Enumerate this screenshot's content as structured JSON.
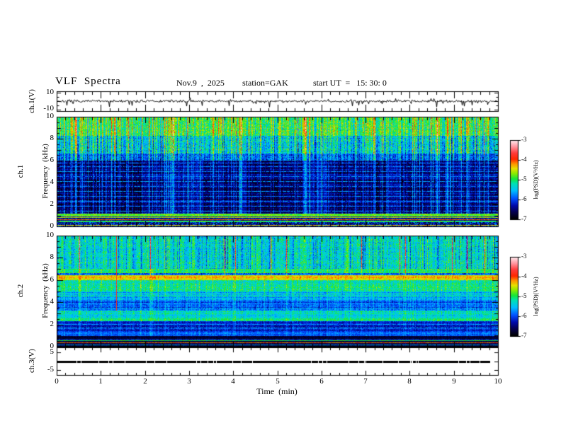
{
  "header": {
    "title": "VLF  Spectra",
    "date": "Nov.9  ,  2025",
    "station": "station=GAK",
    "start_ut": "start UT  =   15: 30: 0"
  },
  "panels": {
    "ch1_wave": {
      "ylabel": "ch.1(V)",
      "yticks": [
        "10",
        "-10"
      ]
    },
    "spec1": {
      "channel": "ch.1",
      "ylabel": "Frequency  (kHz)",
      "yticks": [
        "10",
        "8",
        "6",
        "4",
        "2",
        "0"
      ]
    },
    "spec2": {
      "channel": "ch.2",
      "ylabel": "Frequency  (kHz)",
      "yticks": [
        "10",
        "8",
        "6",
        "4",
        "2",
        "0"
      ]
    },
    "ch3_wave": {
      "ylabel": "ch.3(V)",
      "yticks": [
        "5",
        "-5"
      ]
    }
  },
  "xaxis": {
    "label": "Time  (min)",
    "lim_min": [
      0,
      10
    ],
    "tick_labels": [
      "0",
      "1",
      "2",
      "3",
      "4",
      "5",
      "6",
      "7",
      "8",
      "9",
      "10"
    ],
    "minor_step_min": 0.2
  },
  "colorbar": {
    "label": "log(PSD)(V²/Hz)",
    "ticks": [
      "-3",
      "-4",
      "-5",
      "-6",
      "-7"
    ],
    "range": [
      -7,
      -3
    ]
  },
  "chart_data": [
    {
      "type": "line",
      "name": "ch.1 voltage waveform",
      "ylabel": "ch.1(V)",
      "ylim": [
        -10,
        10
      ],
      "x_range_min": [
        0,
        10
      ],
      "seed": 7,
      "noise_std_v": 0.75,
      "neg_spike_prob": 0.045,
      "neg_spike_depth_v": [
        2,
        6.5
      ],
      "pos_spike_prob": 0.012,
      "pos_spike_height_v": [
        1.5,
        4
      ]
    },
    {
      "type": "heatmap",
      "name": "ch.1 VLF spectrogram",
      "ylabel": "ch.1 Frequency (kHz)",
      "ylim_khz": [
        0,
        10
      ],
      "x_range_min": [
        0,
        10
      ],
      "z_label": "log(PSD)(V²/Hz)",
      "z_range": [
        -7,
        -3
      ],
      "seed": 11,
      "bands": [
        {
          "f_khz": [
            8.3,
            10.0
          ],
          "level": -5.0,
          "noise": 0.45,
          "colvar": 0.5,
          "streak": 0.9,
          "rowvar": 0.15
        },
        {
          "f_khz": [
            6.7,
            8.3
          ],
          "level": -5.5,
          "noise": 0.5,
          "colvar": 0.55,
          "streak": 1.0,
          "rowvar": 0.2
        },
        {
          "f_khz": [
            6.05,
            6.7
          ],
          "level": -5.95,
          "noise": 0.45,
          "colvar": 0.4,
          "streak": 1.0,
          "rowvar": 0.25
        },
        {
          "f_khz": [
            1.2,
            6.05
          ],
          "level": -6.5,
          "noise": 0.28,
          "colvar": 0.18,
          "streak": 0.95,
          "rowvar": 0.5,
          "blocky": 0.55
        },
        {
          "f_khz": [
            0.78,
            1.2
          ],
          "level": -4.75,
          "noise": 0.3,
          "colvar": 0.1,
          "streak": 0.15,
          "rowvar": 0.5
        },
        {
          "f_khz": [
            0.55,
            0.78
          ],
          "level": -6.5,
          "noise": 0.4,
          "colvar": 0.1,
          "streak": 0.15,
          "rowvar": 0.4
        },
        {
          "f_khz": [
            0.38,
            0.55
          ],
          "level": -5.2,
          "noise": 0.4,
          "colvar": 0.1,
          "streak": 0.1,
          "rowvar": 0.4
        },
        {
          "f_khz": [
            0.0,
            0.38
          ],
          "level": -6.3,
          "noise": 0.8,
          "colvar": 0.1,
          "streak": 0.1,
          "rowvar": 0.4
        }
      ],
      "row_lines": [
        {
          "f_khz": 1.45,
          "boost": 0.8
        },
        {
          "f_khz": 1.9,
          "boost": 0.7
        },
        {
          "f_khz": 2.35,
          "boost": 0.8
        },
        {
          "f_khz": 2.8,
          "boost": 0.7
        },
        {
          "f_khz": 3.25,
          "boost": 0.8
        },
        {
          "f_khz": 3.7,
          "boost": 0.7
        },
        {
          "f_khz": 4.15,
          "boost": 0.8
        },
        {
          "f_khz": 4.6,
          "boost": 0.7
        },
        {
          "f_khz": 5.05,
          "boost": 0.75
        },
        {
          "f_khz": 5.5,
          "boost": 0.7
        },
        {
          "f_khz": 5.85,
          "boost": 0.7
        }
      ],
      "solid_rows": [
        {
          "f_khz": 1.08,
          "level": -4.8
        },
        {
          "f_khz": 0.98,
          "level": -4.6
        },
        {
          "f_khz": 0.88,
          "level": -6.3
        },
        {
          "f_khz": 0.65,
          "level": -4.1
        },
        {
          "f_khz": 0.45,
          "level": -5.0
        },
        {
          "f_khz": 0.12,
          "level": -4.4
        }
      ],
      "streaks": {
        "strong_times_min": [
          1.3,
          2.62,
          4.17,
          5.63,
          7.2,
          8.62
        ]
      }
    },
    {
      "type": "heatmap",
      "name": "ch.2 VLF spectrogram",
      "ylabel": "ch.2 Frequency (kHz)",
      "ylim_khz": [
        0,
        10
      ],
      "x_range_min": [
        0,
        10
      ],
      "z_label": "log(PSD)(V²/Hz)",
      "z_range": [
        -7,
        -3
      ],
      "seed": 23,
      "red_column_min": 1.33,
      "bands": [
        {
          "f_khz": [
            7.05,
            10.0
          ],
          "level": -5.2,
          "noise": 0.4,
          "colvar": 0.35,
          "streak": -0.85,
          "rowvar": 0.2
        },
        {
          "f_khz": [
            6.65,
            7.05
          ],
          "level": -5.05,
          "noise": 0.3,
          "colvar": 0.2,
          "streak": 0.3,
          "rowvar": 0.3
        },
        {
          "f_khz": [
            6.5,
            6.65
          ],
          "level": -5.9,
          "noise": 0.4,
          "colvar": 0.15,
          "streak": 0.3,
          "rowvar": 0.3
        },
        {
          "f_khz": [
            6.05,
            6.5
          ],
          "level": -4.4,
          "noise": 0.28,
          "colvar": 0.15,
          "streak": 0.2,
          "rowvar": 0.3
        },
        {
          "f_khz": [
            5.0,
            6.05
          ],
          "level": -5.25,
          "noise": 0.35,
          "colvar": 0.2,
          "streak": 0.4,
          "rowvar": 0.5
        },
        {
          "f_khz": [
            4.25,
            5.0
          ],
          "level": -5.6,
          "noise": 0.3,
          "colvar": 0.15,
          "streak": 0.4,
          "rowvar": 0.5
        },
        {
          "f_khz": [
            3.25,
            4.25
          ],
          "level": -5.95,
          "noise": 0.3,
          "colvar": 0.15,
          "streak": 0.4,
          "rowvar": 0.5
        },
        {
          "f_khz": [
            2.55,
            3.25
          ],
          "level": -5.4,
          "noise": 0.3,
          "colvar": 0.15,
          "streak": 0.35,
          "rowvar": 0.5
        },
        {
          "f_khz": [
            2.3,
            2.55
          ],
          "level": -5.05,
          "noise": 0.3,
          "colvar": 0.1,
          "streak": 0.3,
          "rowvar": 0.5
        },
        {
          "f_khz": [
            1.4,
            2.3
          ],
          "level": -6.3,
          "noise": 0.25,
          "colvar": 0.1,
          "streak": 0.3,
          "rowvar": 0.4
        },
        {
          "f_khz": [
            0.95,
            1.4
          ],
          "level": -5.95,
          "noise": 0.25,
          "colvar": 0.1,
          "streak": 0.25,
          "rowvar": 0.4
        },
        {
          "f_khz": [
            0.0,
            0.95
          ],
          "level": -6.78,
          "noise": 0.18,
          "colvar": 0.05,
          "streak": 0.1,
          "rowvar": 0.3
        }
      ],
      "row_lines": [
        {
          "f_khz": 1.72,
          "boost": 0.7
        },
        {
          "f_khz": 2.02,
          "boost": 0.6
        },
        {
          "f_khz": 3.5,
          "boost": 0.5
        },
        {
          "f_khz": 4.62,
          "boost": 0.5
        }
      ],
      "solid_rows": [
        {
          "f_khz": 0.72,
          "level": -6.1
        },
        {
          "f_khz": 0.55,
          "level": -5.0
        },
        {
          "f_khz": 0.38,
          "level": -4.1
        },
        {
          "f_khz": 0.18,
          "level": -5.7
        }
      ],
      "streaks": {
        "strong_times_min": [
          0.5,
          2.1,
          3.8,
          5.2,
          6.9,
          7.9,
          9.3
        ]
      }
    },
    {
      "type": "line",
      "name": "ch.3 voltage waveform",
      "ylabel": "ch.3(V)",
      "ylim": [
        -5,
        5
      ],
      "value_v": 0,
      "extent_min": [
        0,
        9.82
      ],
      "seed": 5
    }
  ]
}
